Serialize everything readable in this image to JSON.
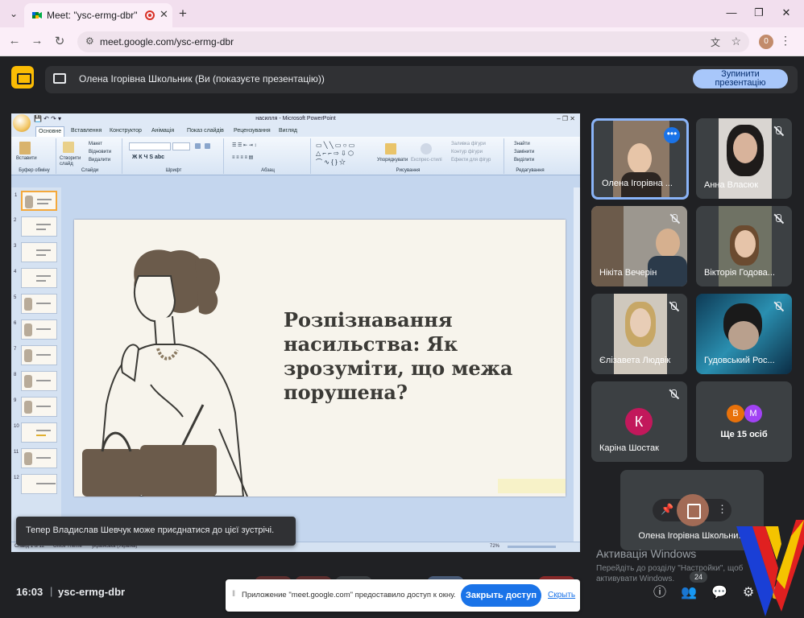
{
  "browser": {
    "tab_title": "Meet: \"ysc-ermg-dbr\"",
    "url": "meet.google.com/ysc-ermg-dbr",
    "profile_initial": "0"
  },
  "presentation_bar": {
    "presenter_text": "Олена Ігорівна Школьник (Ви (показуєте презентацію))",
    "stop_button": "Зупинити\nпрезентацію",
    "accent_color": "#fbbc04"
  },
  "powerpoint": {
    "window_title": "насилля - Microsoft PowerPoint",
    "ribbon_tabs": [
      "Основне",
      "Вставлення",
      "Конструктор",
      "Анімація",
      "Показ слайдів",
      "Рецензування",
      "Вигляд"
    ],
    "groups": [
      "Буфер обміну",
      "Слайди",
      "Шрифт",
      "Абзац",
      "Рисування",
      "Редагування"
    ],
    "buttons": {
      "paste": "Вставити",
      "new_slide": "Створити слайд",
      "layout": "Макет",
      "reset": "Відновити",
      "delete": "Видалити",
      "arrange": "Упорядкувати",
      "quick_styles": "Експрес-стилі",
      "fill": "Заливка фігури",
      "outline": "Контур фігури",
      "effects": "Ефекти для фігур",
      "find": "Знайти",
      "replace": "Замінити",
      "select": "Виділити"
    },
    "slide_numbers": [
      "1",
      "2",
      "3",
      "4",
      "5",
      "6",
      "7",
      "8",
      "9",
      "10",
      "11",
      "12"
    ],
    "slide_title": "Розпізнавання насильства: Як зрозуміти, що межа порушена?",
    "status_left": "Слайд 1 із 12",
    "status_theme": "Office Theme",
    "status_lang": "українська (Україна)",
    "zoom": "72%"
  },
  "participants": [
    {
      "name": "Олена Ігорівна ...",
      "muted": false,
      "active": true
    },
    {
      "name": "Анна Власюк",
      "muted": true
    },
    {
      "name": "Нікіта Вечерін",
      "muted": true
    },
    {
      "name": "Вікторія Годова...",
      "muted": true
    },
    {
      "name": "Єлізавета Людвік",
      "muted": true
    },
    {
      "name": "Гудовський Рос...",
      "muted": true
    },
    {
      "name": "Каріна Шостак",
      "muted": true,
      "avatar_letter": "К",
      "avatar_color": "#c2185b"
    },
    {
      "name": "Ще 15 осіб",
      "avatars": [
        "В",
        "М"
      ]
    }
  ],
  "self_tile": {
    "name": "Олена Ігорівна Школьни..."
  },
  "toast": "Тепер Владислав Шевчук може приєднатися до цієї зустрічі.",
  "windows_activation": {
    "title": "Активація Windows",
    "text": "Перейдіть до розділу \"Настройки\", щоб активувати Windows."
  },
  "footer": {
    "time": "16:03",
    "separator": "|",
    "meeting_code": "ysc-ermg-dbr",
    "participant_count": "24"
  },
  "share_bar": {
    "message": "Приложение \"meet.google.com\" предоставило доступ к окну.",
    "stop": "Закрыть доступ",
    "hide": "Скрыть"
  }
}
